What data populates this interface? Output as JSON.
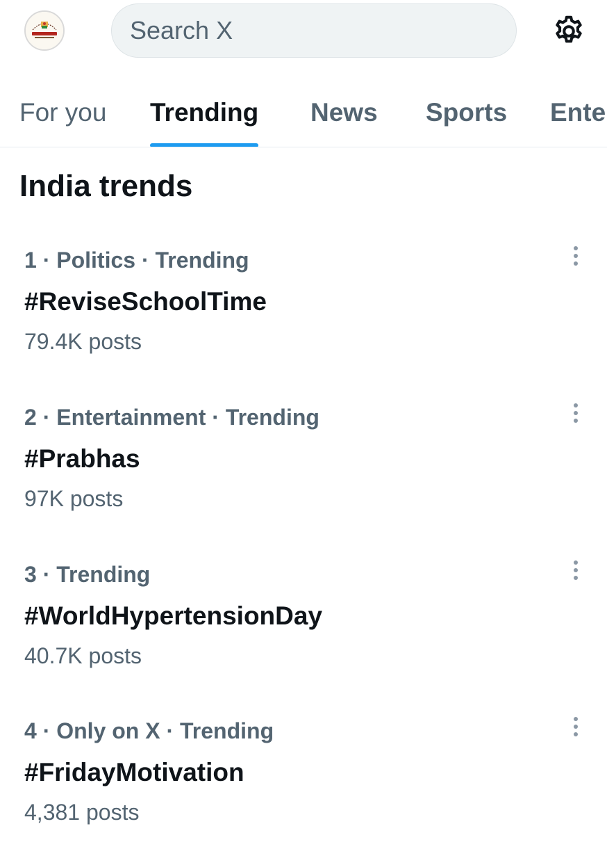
{
  "header": {
    "avatar_alt": "Profile",
    "search_placeholder": "Search X",
    "settings_icon": "gear-icon"
  },
  "tabs": [
    {
      "label": "For you",
      "active": false
    },
    {
      "label": "Trending",
      "active": true
    },
    {
      "label": "News",
      "active": false
    },
    {
      "label": "Sports",
      "active": false
    },
    {
      "label": "Ente",
      "active": false
    }
  ],
  "section": {
    "title": "India trends"
  },
  "trends": [
    {
      "meta": "1 · Politics · Trending",
      "tag": "#ReviseSchoolTime",
      "count": "79.4K posts"
    },
    {
      "meta": "2 · Entertainment · Trending",
      "tag": "#Prabhas",
      "count": "97K posts"
    },
    {
      "meta": "3 · Trending",
      "tag": "#WorldHypertensionDay",
      "count": "40.7K posts"
    },
    {
      "meta": "4 · Only on X · Trending",
      "tag": "#FridayMotivation",
      "count": "4,381 posts"
    }
  ],
  "colors": {
    "accent": "#1d9bf0",
    "primary_text": "#0f1419",
    "secondary_text": "#536471",
    "search_bg": "#eff3f4"
  }
}
